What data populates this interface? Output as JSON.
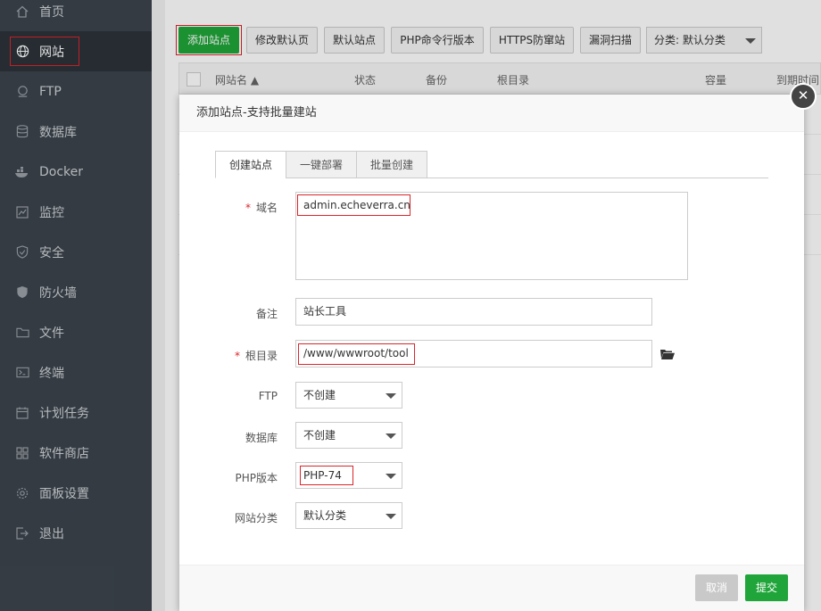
{
  "sidebar": {
    "items": [
      {
        "label": "首页",
        "icon": "home-icon"
      },
      {
        "label": "网站",
        "icon": "globe-icon"
      },
      {
        "label": "FTP",
        "icon": "ftp-icon"
      },
      {
        "label": "数据库",
        "icon": "database-icon"
      },
      {
        "label": "Docker",
        "icon": "docker-icon"
      },
      {
        "label": "监控",
        "icon": "monitor-icon"
      },
      {
        "label": "安全",
        "icon": "shield-icon"
      },
      {
        "label": "防火墙",
        "icon": "firewall-icon"
      },
      {
        "label": "文件",
        "icon": "folder-icon"
      },
      {
        "label": "终端",
        "icon": "terminal-icon"
      },
      {
        "label": "计划任务",
        "icon": "calendar-icon"
      },
      {
        "label": "软件商店",
        "icon": "grid-icon"
      },
      {
        "label": "面板设置",
        "icon": "gear-icon"
      },
      {
        "label": "退出",
        "icon": "logout-icon"
      }
    ]
  },
  "toolbar": {
    "add_site": "添加站点",
    "edit_default": "修改默认页",
    "default_site": "默认站点",
    "php_cli": "PHP命令行版本",
    "https_guard": "HTTPS防窜站",
    "vuln_scan": "漏洞扫描",
    "category": "分类: 默认分类"
  },
  "table": {
    "headers": {
      "name": "网站名 ▲",
      "status": "状态",
      "backup": "备份",
      "root": "根目录",
      "size": "容量",
      "expire": "到期时间"
    }
  },
  "modal": {
    "title": "添加站点-支持批量建站",
    "tabs": [
      "创建站点",
      "一键部署",
      "批量创建"
    ],
    "fields": {
      "domain_label": "域名",
      "domain_value": "admin.echeverra.cn",
      "remark_label": "备注",
      "remark_value": "站长工具",
      "root_label": "根目录",
      "root_value": "/www/wwwroot/tool",
      "ftp_label": "FTP",
      "ftp_value": "不创建",
      "db_label": "数据库",
      "db_value": "不创建",
      "php_label": "PHP版本",
      "php_value": "PHP-74",
      "category_label": "网站分类",
      "category_value": "默认分类"
    },
    "required_mark": "*",
    "cancel": "取消",
    "submit": "提交",
    "close": "✕"
  },
  "colors": {
    "sidebar_bg": "#3c444d",
    "accent_green": "#20a53a",
    "highlight_red": "#d9262c"
  }
}
